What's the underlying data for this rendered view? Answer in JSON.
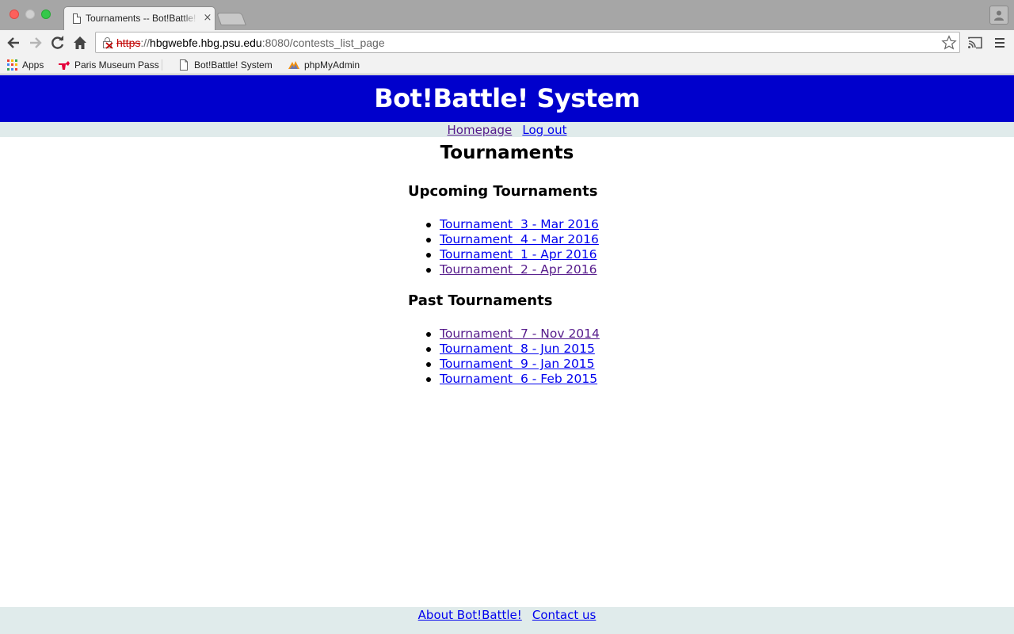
{
  "browser": {
    "tab_title": "Tournaments -- Bot!Battle! System",
    "tab_close_glyph": "×",
    "url": {
      "scheme": "https",
      "separator": "://",
      "host": "hbgwebfe.hbg.psu.edu",
      "rest": ":8080/contests_list_page"
    },
    "bookmarks": [
      {
        "label": "Apps",
        "icon": "apps-grid-icon"
      },
      {
        "label": "Paris Museum Pass",
        "icon": "paris-museum-pass-icon"
      },
      {
        "label": "Bot!Battle! System",
        "icon": "page-icon"
      },
      {
        "label": "phpMyAdmin",
        "icon": "phpmyadmin-icon"
      }
    ]
  },
  "site": {
    "title": "Bot!Battle! System",
    "nav": {
      "homepage": "Homepage",
      "logout": "Log out"
    },
    "footer": {
      "about": "About Bot!Battle!",
      "contact": "Contact us"
    }
  },
  "main": {
    "title": "Tournaments",
    "upcoming": {
      "heading": "Upcoming Tournaments",
      "items": [
        {
          "label": "Tournament  3 - Mar 2016",
          "visited": false
        },
        {
          "label": "Tournament  4 - Mar 2016",
          "visited": false
        },
        {
          "label": "Tournament  1 - Apr 2016",
          "visited": false
        },
        {
          "label": "Tournament  2 - Apr 2016",
          "visited": true
        }
      ]
    },
    "past": {
      "heading": "Past Tournaments",
      "items": [
        {
          "label": "Tournament  7 - Nov 2014",
          "visited": true
        },
        {
          "label": "Tournament  8 - Jun 2015",
          "visited": false
        },
        {
          "label": "Tournament  9 - Jan 2015",
          "visited": false
        },
        {
          "label": "Tournament  6 - Feb 2015",
          "visited": false
        }
      ]
    }
  },
  "colors": {
    "header_bg": "#0000cc",
    "nav_bg": "#e0ebeb",
    "link": "#0000ee",
    "visited_link": "#551a8b"
  }
}
